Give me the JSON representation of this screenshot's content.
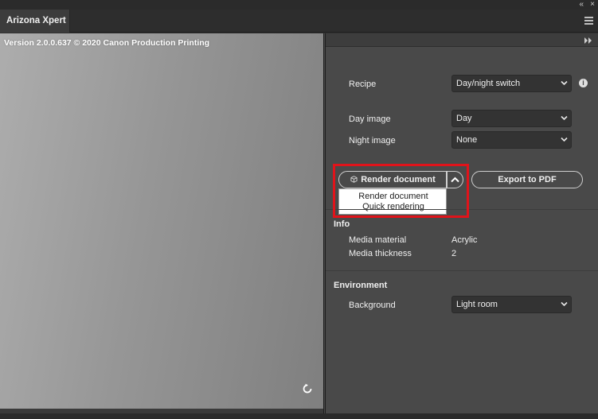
{
  "window": {
    "tab_title": "Arizona Xpert",
    "collapse_glyph": "«",
    "close_glyph": "×"
  },
  "preview": {
    "version_text": "Version 2.0.0.637 © 2020 Canon Production Printing"
  },
  "settings": {
    "recipe": {
      "label": "Recipe",
      "value": "Day/night switch"
    },
    "day_image": {
      "label": "Day image",
      "value": "Day"
    },
    "night_image": {
      "label": "Night image",
      "value": "None"
    },
    "render_button_label": "Render document",
    "export_button_label": "Export to PDF",
    "render_menu": {
      "items": [
        {
          "label": "Render document"
        },
        {
          "label": "Quick rendering"
        }
      ]
    },
    "info": {
      "title": "Info",
      "media_material": {
        "label": "Media material",
        "value": "Acrylic"
      },
      "media_thickness": {
        "label": "Media thickness",
        "value": "2"
      }
    },
    "environment": {
      "title": "Environment",
      "background": {
        "label": "Background",
        "value": "Light room"
      }
    }
  },
  "colors": {
    "panel_bg": "#494949",
    "control_bg": "#333333",
    "highlight": "#e0131a"
  },
  "icons": [
    "collapse-panel-icon",
    "close-icon",
    "panel-menu-icon",
    "expand-icon",
    "info-icon",
    "chevron-down-icon",
    "chevron-up-icon",
    "cube-icon",
    "refresh-icon"
  ]
}
